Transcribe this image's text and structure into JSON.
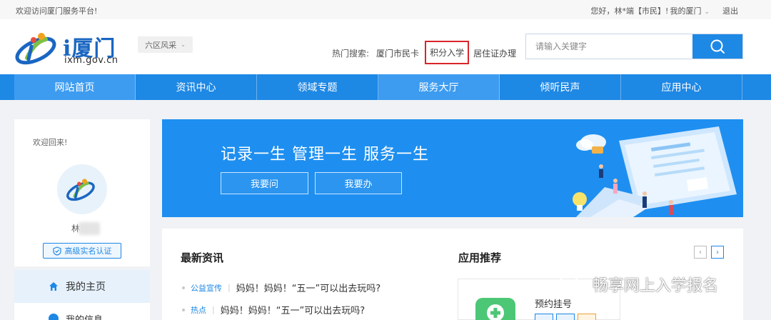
{
  "topbar": {
    "welcome": "欢迎访问厦门服务平台!",
    "greeting": "您好，林*端【市民】!",
    "my_xiamen": "我的厦门",
    "logout": "退出"
  },
  "header": {
    "brand": "i厦门",
    "domain": "ixm.gov.cn",
    "region_select": "六区风采",
    "hot_search_label": "热门搜索:",
    "hot_keywords": [
      "厦门市民卡",
      "积分入学",
      "居住证办理"
    ],
    "search_placeholder": "请输入关键字"
  },
  "nav": {
    "items": [
      "网站首页",
      "资讯中心",
      "领域专题",
      "服务大厅",
      "倾听民声",
      "应用中心"
    ],
    "active": "服务大厅"
  },
  "sidebar": {
    "welcome_back": "欢迎回来!",
    "username_visible": "林",
    "verify_badge": "高级实名认证",
    "menu": [
      "我的主页",
      "我的信息"
    ]
  },
  "banner": {
    "slogan": "记录一生   管理一生   服务一生",
    "btn_ask": "我要问",
    "btn_do": "我要办"
  },
  "news": {
    "title": "最新资讯",
    "items": [
      {
        "tag": "公益宣传",
        "text": "妈妈！妈妈！“五一”可以出去玩吗?"
      },
      {
        "tag": "热点",
        "text": "妈妈！妈妈！“五一”可以出去玩吗?"
      }
    ]
  },
  "apps": {
    "title": "应用推荐",
    "first_app": "预约挂号"
  },
  "watermark": "畅享网上入学报名",
  "colors": {
    "primary": "#1e88e5",
    "highlight_box": "#d9252a",
    "app_green": "#4cc776"
  }
}
